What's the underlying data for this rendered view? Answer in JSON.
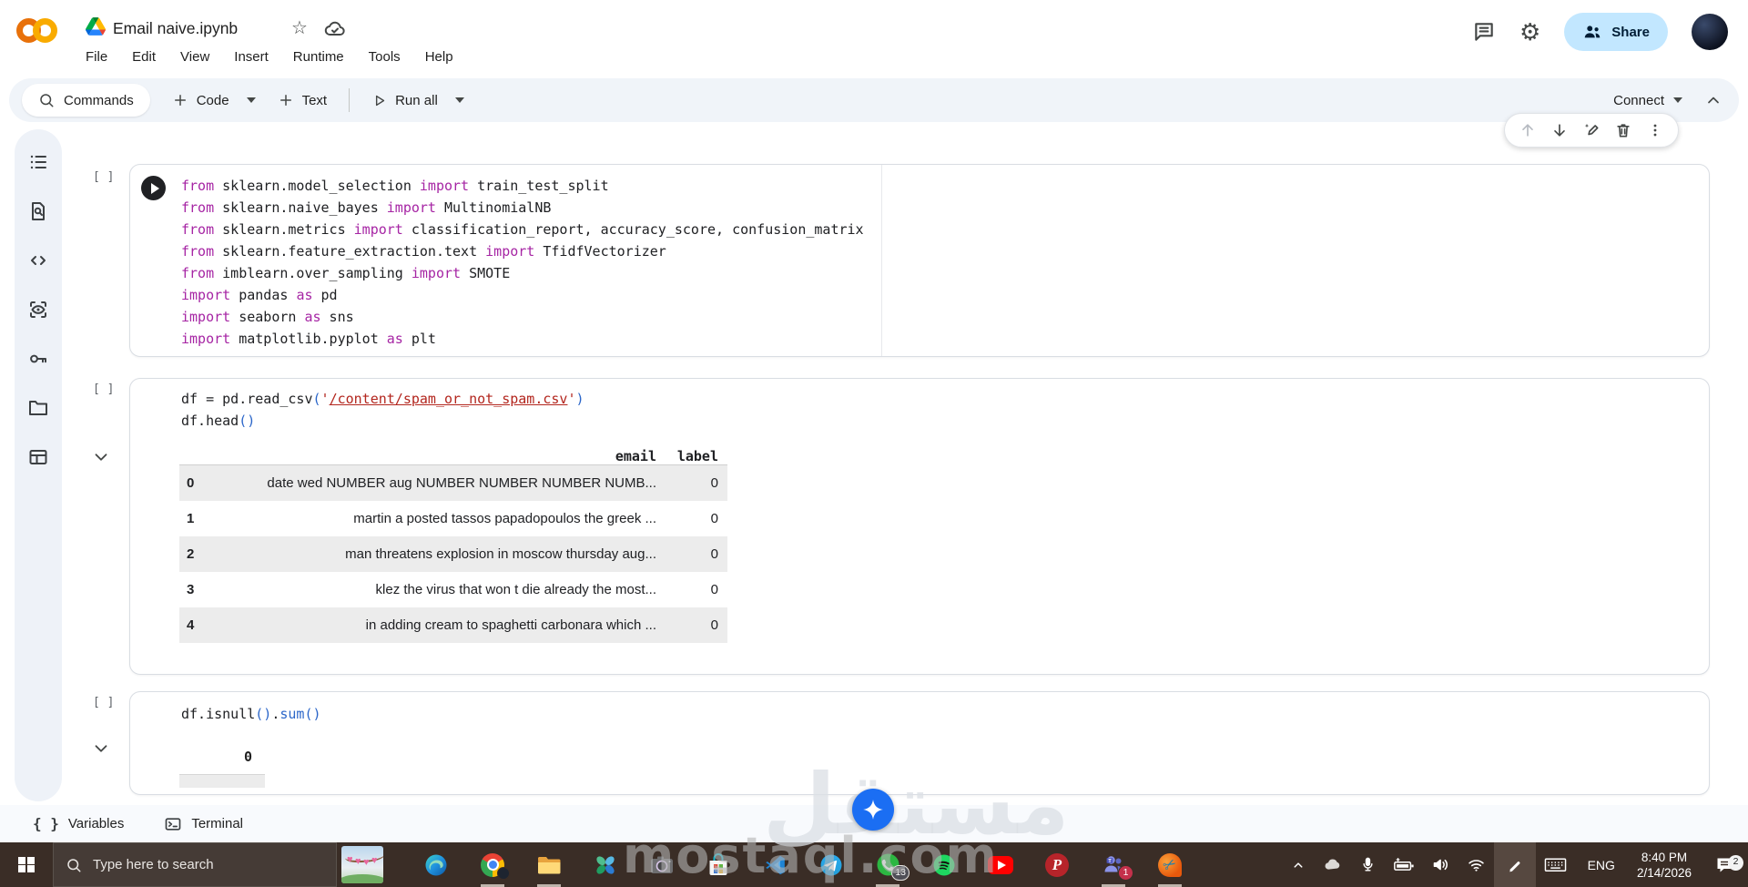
{
  "header": {
    "title": "Email naive.ipynb",
    "menus": [
      "File",
      "Edit",
      "View",
      "Insert",
      "Runtime",
      "Tools",
      "Help"
    ],
    "share_label": "Share",
    "icons": [
      "colab-logo",
      "drive-icon",
      "star-icon",
      "cloud-saved-icon",
      "comments-icon",
      "settings-gear-icon",
      "avatar"
    ]
  },
  "toolbar": {
    "commands_label": "Commands",
    "code_label": "Code",
    "text_label": "Text",
    "run_all_label": "Run all",
    "connect_label": "Connect"
  },
  "sidebar_icons": [
    "table-of-contents",
    "find-in-page",
    "code-snippets",
    "eye-scan",
    "secrets-key",
    "files-folder",
    "data-table"
  ],
  "cell_toolbar_icons": [
    "move-up",
    "move-down",
    "gemini-edit",
    "delete",
    "more-options"
  ],
  "cells": [
    {
      "gutter": "[ ]",
      "code": [
        [
          {
            "c": "kw",
            "t": "from"
          },
          {
            "c": "pl",
            "t": " sklearn.model_selection "
          },
          {
            "c": "kw",
            "t": "import"
          },
          {
            "c": "pl",
            "t": " train_test_split"
          }
        ],
        [
          {
            "c": "kw",
            "t": "from"
          },
          {
            "c": "pl",
            "t": " sklearn.naive_bayes "
          },
          {
            "c": "kw",
            "t": "import"
          },
          {
            "c": "pl",
            "t": " MultinomialNB"
          }
        ],
        [
          {
            "c": "kw",
            "t": "from"
          },
          {
            "c": "pl",
            "t": " sklearn.metrics "
          },
          {
            "c": "kw",
            "t": "import"
          },
          {
            "c": "pl",
            "t": " classification_report, accuracy_score, confusion_matrix"
          }
        ],
        [
          {
            "c": "kw",
            "t": "from"
          },
          {
            "c": "pl",
            "t": " sklearn.feature_extraction.text "
          },
          {
            "c": "kw",
            "t": "import"
          },
          {
            "c": "pl",
            "t": " TfidfVectorizer"
          }
        ],
        [
          {
            "c": "kw",
            "t": "from"
          },
          {
            "c": "pl",
            "t": " imblearn.over_sampling "
          },
          {
            "c": "kw",
            "t": "import"
          },
          {
            "c": "pl",
            "t": " SMOTE"
          }
        ],
        [
          {
            "c": "kw",
            "t": "import"
          },
          {
            "c": "pl",
            "t": " pandas "
          },
          {
            "c": "kw",
            "t": "as"
          },
          {
            "c": "pl",
            "t": " pd"
          }
        ],
        [
          {
            "c": "kw",
            "t": "import"
          },
          {
            "c": "pl",
            "t": " seaborn "
          },
          {
            "c": "kw",
            "t": "as"
          },
          {
            "c": "pl",
            "t": " sns"
          }
        ],
        [
          {
            "c": "kw",
            "t": "import"
          },
          {
            "c": "pl",
            "t": " matplotlib.pyplot "
          },
          {
            "c": "kw",
            "t": "as"
          },
          {
            "c": "pl",
            "t": " plt"
          }
        ]
      ]
    },
    {
      "gutter": "[ ]",
      "code": [
        [
          {
            "c": "pl",
            "t": "df = pd.read_csv"
          },
          {
            "c": "br",
            "t": "("
          },
          {
            "c": "st",
            "t": "'"
          },
          {
            "c": "lk",
            "t": "/content/spam_or_not_spam.csv"
          },
          {
            "c": "st",
            "t": "'"
          },
          {
            "c": "br",
            "t": ")"
          }
        ],
        [
          {
            "c": "pl",
            "t": "df.head"
          },
          {
            "c": "br",
            "t": "()"
          }
        ]
      ],
      "output_table": {
        "headers": [
          "",
          "email",
          "label"
        ],
        "rows": [
          [
            "0",
            "date wed NUMBER aug NUMBER NUMBER NUMBER NUMB...",
            "0"
          ],
          [
            "1",
            "martin a posted tassos papadopoulos the greek ...",
            "0"
          ],
          [
            "2",
            "man threatens explosion in moscow thursday aug...",
            "0"
          ],
          [
            "3",
            "klez the virus that won t die already the most...",
            "0"
          ],
          [
            "4",
            "in adding cream to spaghetti carbonara which ...",
            "0"
          ]
        ]
      }
    },
    {
      "gutter": "[ ]",
      "code": [
        [
          {
            "c": "pl",
            "t": "df.isnull"
          },
          {
            "c": "br",
            "t": "()"
          },
          {
            "c": "pl",
            "t": "."
          },
          {
            "c": "fn",
            "t": "sum"
          },
          {
            "c": "br",
            "t": "()"
          }
        ]
      ],
      "output": {
        "header": "0"
      }
    }
  ],
  "bottom_bar": {
    "variables_label": "Variables",
    "terminal_label": "Terminal"
  },
  "taskbar": {
    "search_placeholder": "Type here to search",
    "app_icons": [
      "windows-start",
      "weather-interests",
      "edge",
      "chrome",
      "file-explorer",
      "photos",
      "camera",
      "microsoft-store",
      "vscode",
      "telegram",
      "whatsapp",
      "spotify",
      "youtube",
      "pinterest",
      "teams",
      "clipchamp"
    ],
    "tray_icons": [
      "chevron-up",
      "onedrive",
      "microphone",
      "battery-charging",
      "volume",
      "wifi",
      "windows-ink-pen",
      "touch-keyboard",
      "notifications"
    ],
    "whatsapp_badge": "13",
    "teams_badge": "1",
    "notification_badge": "2",
    "language": "ENG",
    "time": "8:40 PM",
    "date": "2/14/2026"
  },
  "watermark": {
    "arabic": "مستقل",
    "site": "mostaql.com"
  },
  "colors": {
    "accent_blue": "#1b6ef3",
    "share_pill": "#c2e7ff",
    "toolbar_bg": "#f0f4f9",
    "taskbar_bg": "#3a2d26",
    "keyword": "#a625a4",
    "string": "#b3261e",
    "bracket": "#2b66c9",
    "stripe": "#ececec"
  }
}
